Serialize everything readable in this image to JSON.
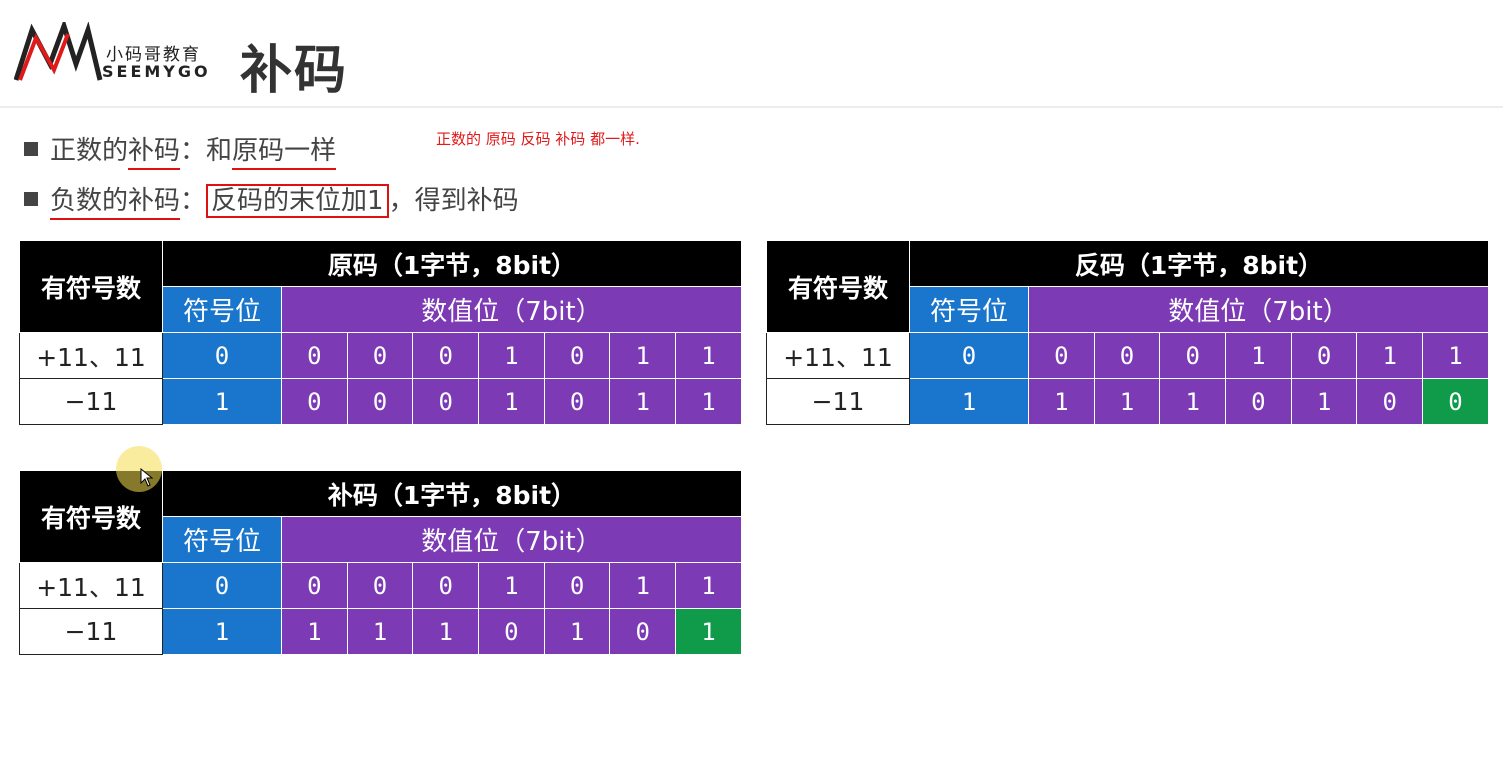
{
  "header": {
    "logo_cn": "小码哥教育",
    "logo_en": "SEEMYGO",
    "title": "补码"
  },
  "bullets": {
    "b1_prefix": "正数的",
    "b1_underlined": "补码",
    "b1_colon": "：",
    "b1_gap": "和",
    "b1_underlined2": "原码一样",
    "b2_underlined": "负数的补码",
    "b2_colon": "：",
    "b2_boxed": "反码的末位加1",
    "b2_suffix": "，得到补码"
  },
  "annotation": "正数的 原码  反码 补码 都一样.",
  "tables": {
    "original": {
      "row_header": "有符号数",
      "title": "原码（1字节，8bit）",
      "sign_header": "符号位",
      "value_header": "数值位（7bit）",
      "rows": [
        {
          "label": "+11、11",
          "bits": [
            "0",
            "0",
            "0",
            "0",
            "1",
            "0",
            "1",
            "1"
          ]
        },
        {
          "label": "−11",
          "bits": [
            "1",
            "0",
            "0",
            "0",
            "1",
            "0",
            "1",
            "1"
          ]
        }
      ]
    },
    "ones": {
      "row_header": "有符号数",
      "title": "反码（1字节，8bit）",
      "sign_header": "符号位",
      "value_header": "数值位（7bit）",
      "rows": [
        {
          "label": "+11、11",
          "bits": [
            "0",
            "0",
            "0",
            "0",
            "1",
            "0",
            "1",
            "1"
          ]
        },
        {
          "label": "−11",
          "bits": [
            "1",
            "1",
            "1",
            "1",
            "0",
            "1",
            "0",
            "0"
          ]
        }
      ]
    },
    "twos": {
      "row_header": "有符号数",
      "title": "补码（1字节，8bit）",
      "sign_header": "符号位",
      "value_header": "数值位（7bit）",
      "rows": [
        {
          "label": "+11、11",
          "bits": [
            "0",
            "0",
            "0",
            "0",
            "1",
            "0",
            "1",
            "1"
          ]
        },
        {
          "label": "−11",
          "bits": [
            "1",
            "1",
            "1",
            "1",
            "0",
            "1",
            "0",
            "1"
          ]
        }
      ]
    }
  },
  "colors": {
    "sign_bit": "#1a76cc",
    "value_bits": "#7c3ab4",
    "highlight": "#0f9b4a",
    "annotation": "#e01a1a"
  }
}
